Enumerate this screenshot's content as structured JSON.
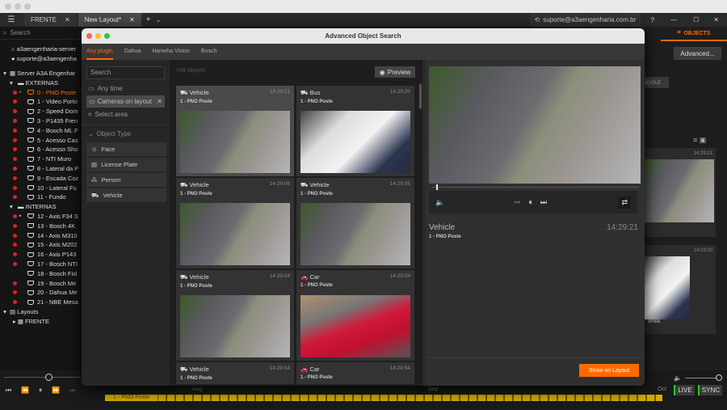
{
  "app": {
    "tabs": [
      {
        "label": "FRENTE"
      },
      {
        "label": "New Layout*"
      }
    ],
    "user": "suporte@a3aengenharia.com.br",
    "search_placeholder": "Search",
    "objects_tab": "OBJECTS",
    "advanced_button": "Advanced...",
    "bg_chip": "ayout",
    "bg_times": [
      "14:29:21",
      "14:29:20"
    ],
    "bg_label": "White"
  },
  "tree": {
    "server_host": "a3aengenharia-server",
    "user": "suporte@a3aengenha",
    "server": "Server A3A Engenhar",
    "groups": [
      {
        "name": "EXTERNAS",
        "cameras": [
          "0 - PNO Poste",
          "1 - Video Porto",
          "2 - Speed Dom",
          "3 - P1435 Fren",
          "4 - Bosch ML F",
          "5 - Acesso Cas",
          "6 - Acesso Sho",
          "7 - NTI Muro",
          "8 - Lateral da P",
          "9 - Escada Coz",
          "10 - Lateral Fu",
          "11 - Fundo"
        ]
      },
      {
        "name": "INTERNAS",
        "cameras": [
          "12 - Axis F34 S",
          "13 - Bosch 4K",
          "14 - Axis M310",
          "15 - Axis M202",
          "16 - Axis P143",
          "17 - Bosch NTI",
          "18 - Bosch Fisl",
          "19 - Bosch Me",
          "20 - Dahua Me",
          "21 - NBE Mesa"
        ]
      }
    ],
    "layouts": "Layouts",
    "layout_items": [
      "FRENTE"
    ]
  },
  "modal": {
    "title": "Advanced Object Search",
    "plugin_tabs": [
      "Any plugin",
      "Dahua",
      "Hanwha Vision",
      "Bosch"
    ],
    "filters": {
      "search_placeholder": "Search",
      "any_time": "Any time",
      "cameras_chip": "Cameras on layout",
      "select_area": "Select area",
      "object_type": "Object Type",
      "types": [
        "Face",
        "License Plate",
        "Person",
        "Vehicle"
      ]
    },
    "count": ">99 objects",
    "preview_button": "Preview",
    "results": [
      {
        "type": "Vehicle",
        "time": "14:29:21",
        "camera": "1 - PNO Poste",
        "img": "street"
      },
      {
        "type": "Bus",
        "time": "14:29:20",
        "camera": "1 - PNO Poste",
        "img": "van"
      },
      {
        "type": "Vehicle",
        "time": "14:29:06",
        "camera": "1 - PNO Poste",
        "img": "street"
      },
      {
        "type": "Vehicle",
        "time": "14:29:05",
        "camera": "1 - PNO Poste",
        "img": "street"
      },
      {
        "type": "Vehicle",
        "time": "14:29:04",
        "camera": "1 - PNO Poste",
        "img": "street"
      },
      {
        "type": "Car",
        "time": "14:29:04",
        "camera": "1 - PNO Poste",
        "img": "redcar"
      },
      {
        "type": "Vehicle",
        "time": "14:29:04",
        "camera": "1 - PNO Poste",
        "img": "street"
      },
      {
        "type": "Car",
        "time": "14:28:54",
        "camera": "1 - PNO Poste",
        "img": "redcar"
      }
    ],
    "detail": {
      "type": "Vehicle",
      "time": "14:29:21",
      "camera": "1 - PNO Poste",
      "progress": 0.02
    },
    "show_on_layout": "Show on Layout"
  },
  "timeline": {
    "months": [
      "Aug",
      "Sep",
      "Oct"
    ],
    "camera_label": "1 - PNO Poste",
    "live": "LIVE",
    "sync": "SYNC",
    "accent": "#ff6a00"
  }
}
